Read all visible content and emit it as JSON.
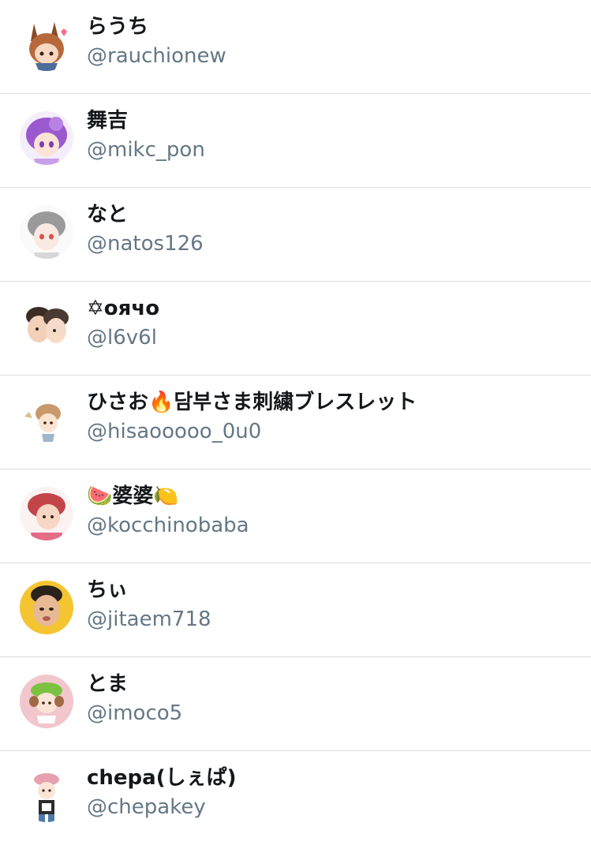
{
  "users": [
    {
      "name": "らうち",
      "handle": "@rauchionew",
      "avatar": "avatar-anime-bunny-ears",
      "color": "#b66a3c"
    },
    {
      "name": "舞吉",
      "handle": "@mikc_pon",
      "avatar": "avatar-anime-purple-hair",
      "color": "#9b59d0"
    },
    {
      "name": "なと",
      "handle": "@natos126",
      "avatar": "avatar-anime-gray-hair",
      "color": "#9a9a9a"
    },
    {
      "name": "✡︎оячо",
      "handle": "@l6v6l",
      "avatar": "avatar-anime-couple",
      "color": "#4a3a32"
    },
    {
      "name": "ひさお🔥담부さま刺繍ブレスレット",
      "handle": "@hisaooooo_0u0",
      "avatar": "avatar-anime-chibi",
      "color": "#c89a6a"
    },
    {
      "name": "🍉婆婆🍋",
      "handle": "@kocchinobaba",
      "avatar": "avatar-anime-red-hair",
      "color": "#c2454a"
    },
    {
      "name": "ちぃ",
      "handle": "@jitaem718",
      "avatar": "avatar-photo-yellow",
      "color": "#f5c431"
    },
    {
      "name": "とま",
      "handle": "@imoco5",
      "avatar": "avatar-anime-green-hat",
      "color": "#f1c6cc"
    },
    {
      "name": "chepa(しぇぱ)",
      "handle": "@chepakey",
      "avatar": "avatar-anime-pink-beret",
      "color": "#e7a0b0"
    }
  ]
}
